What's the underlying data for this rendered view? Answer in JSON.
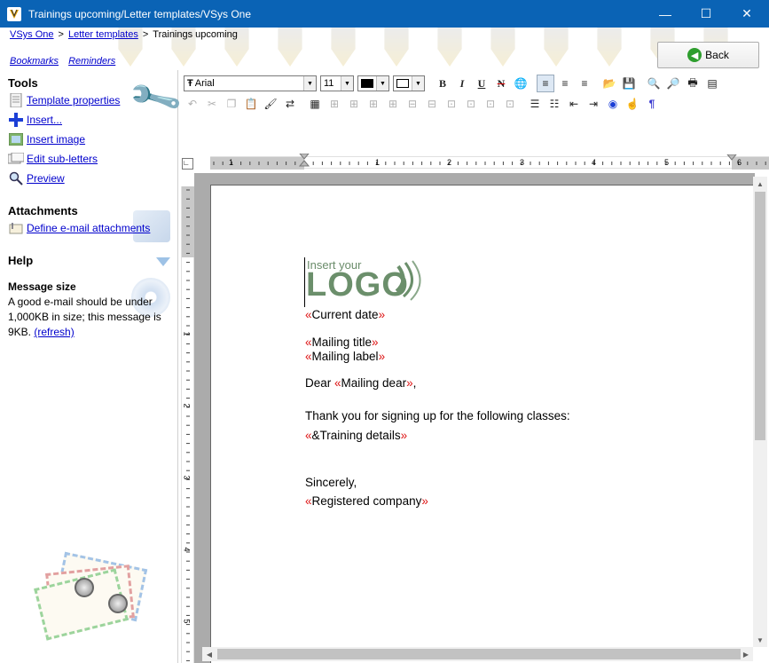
{
  "window": {
    "title": "Trainings upcoming/Letter templates/VSys One",
    "minimize_glyph": "—",
    "maximize_glyph": "☐",
    "close_glyph": "✕"
  },
  "breadcrumb": {
    "items": [
      "VSys One",
      "Letter templates",
      "Trainings upcoming"
    ],
    "separator": ">"
  },
  "sublinks": {
    "bookmarks": "Bookmarks",
    "reminders": "Reminders"
  },
  "back_button": {
    "label": "Back",
    "icon": "back-arrow-icon"
  },
  "left_pane": {
    "tools_heading": "Tools",
    "tools": [
      {
        "label": "Template properties",
        "icon": "document-icon"
      },
      {
        "label": "Insert...",
        "icon": "plus-icon"
      },
      {
        "label": "Insert image",
        "icon": "image-icon"
      },
      {
        "label": "Edit sub-letters",
        "icon": "sub-letters-icon"
      },
      {
        "label": "Preview",
        "icon": "magnifier-icon"
      }
    ],
    "attachments_heading": "Attachments",
    "attachments_link": "Define e-mail attachments",
    "help_heading": "Help",
    "message_size_title": "Message size",
    "message_size_text": "A good e-mail should be under 1,000KB in size; this message is 9KB.",
    "refresh_link": "(refresh)"
  },
  "toolbar": {
    "font_name": "Arial",
    "font_size": "11",
    "font_glyph": "Ŧ",
    "bold": "B",
    "italic": "I",
    "underline": "U",
    "strike": "N",
    "pilcrow": "¶"
  },
  "ruler": {
    "h_labels": [
      "1",
      "1",
      "2",
      "3",
      "4",
      "5",
      "6"
    ],
    "v_labels": [
      "1",
      "2",
      "3",
      "4",
      "5"
    ]
  },
  "document": {
    "logo_small": "Insert your",
    "logo_big": "LOGO",
    "open_quote": "«",
    "close_quote": "»",
    "current_date": "Current date",
    "mailing_title": "Mailing title",
    "mailing_label": "Mailing label",
    "dear_prefix": "Dear ",
    "mailing_dear": "Mailing dear",
    "dear_suffix": ",",
    "thank_you": "Thank you for signing up for the following classes:",
    "training_details": "&Training details",
    "sincerely": "Sincerely,",
    "registered_company": "Registered company"
  },
  "colors": {
    "titlebar": "#0a63b5",
    "link": "#0000cc",
    "merge_quote": "#dd1111"
  }
}
